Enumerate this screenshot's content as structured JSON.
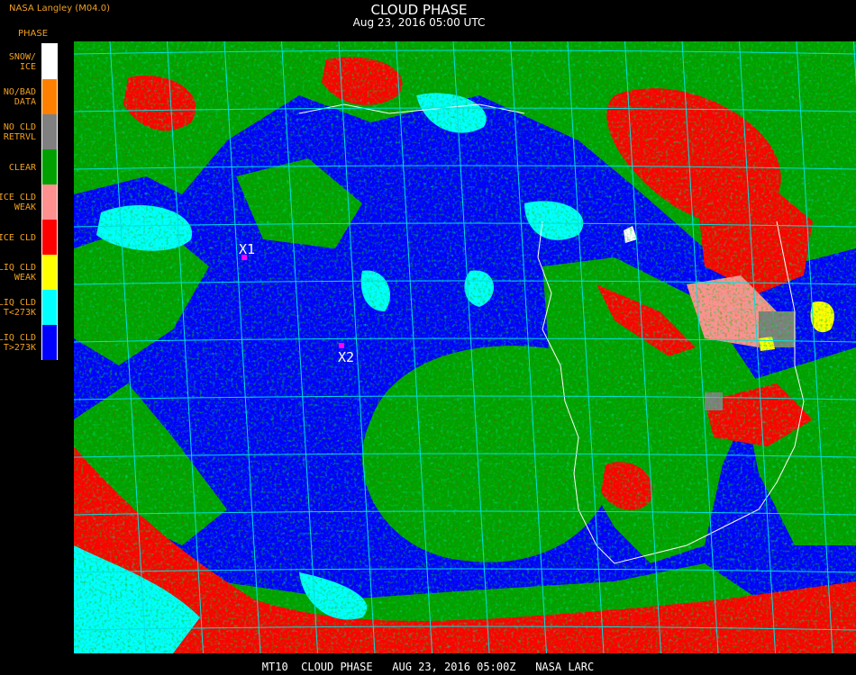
{
  "header": {
    "producer": "NASA Langley (M04.0)",
    "title": "CLOUD PHASE",
    "timestamp": "Aug 23, 2016 05:00 UTC"
  },
  "legend": {
    "heading": "PHASE",
    "items": [
      {
        "label": "SNOW/\nICE",
        "color": "#ffffff"
      },
      {
        "label": "NO/BAD\nDATA",
        "color": "#ff8000"
      },
      {
        "label": "NO CLD\nRETRVL",
        "color": "#808080"
      },
      {
        "label": "CLEAR",
        "color": "#00a000"
      },
      {
        "label": "ICE CLD\nWEAK",
        "color": "#ff9090"
      },
      {
        "label": "ICE CLD",
        "color": "#ff0000"
      },
      {
        "label": "LIQ CLD\nWEAK",
        "color": "#ffff00"
      },
      {
        "label": "LIQ CLD\nT<273K",
        "color": "#00ffff"
      },
      {
        "label": "LIQ CLD\nT>273K",
        "color": "#0000ff"
      }
    ]
  },
  "markers": [
    {
      "label": "X1",
      "color": "#ff00ff"
    },
    {
      "label": "X2",
      "color": "#ff00ff"
    }
  ],
  "footer": "MT10  CLOUD PHASE   AUG 23, 2016 05:00Z   NASA LARC",
  "colors": {
    "grid": "#00e0e0",
    "coast": "#ffffff"
  }
}
